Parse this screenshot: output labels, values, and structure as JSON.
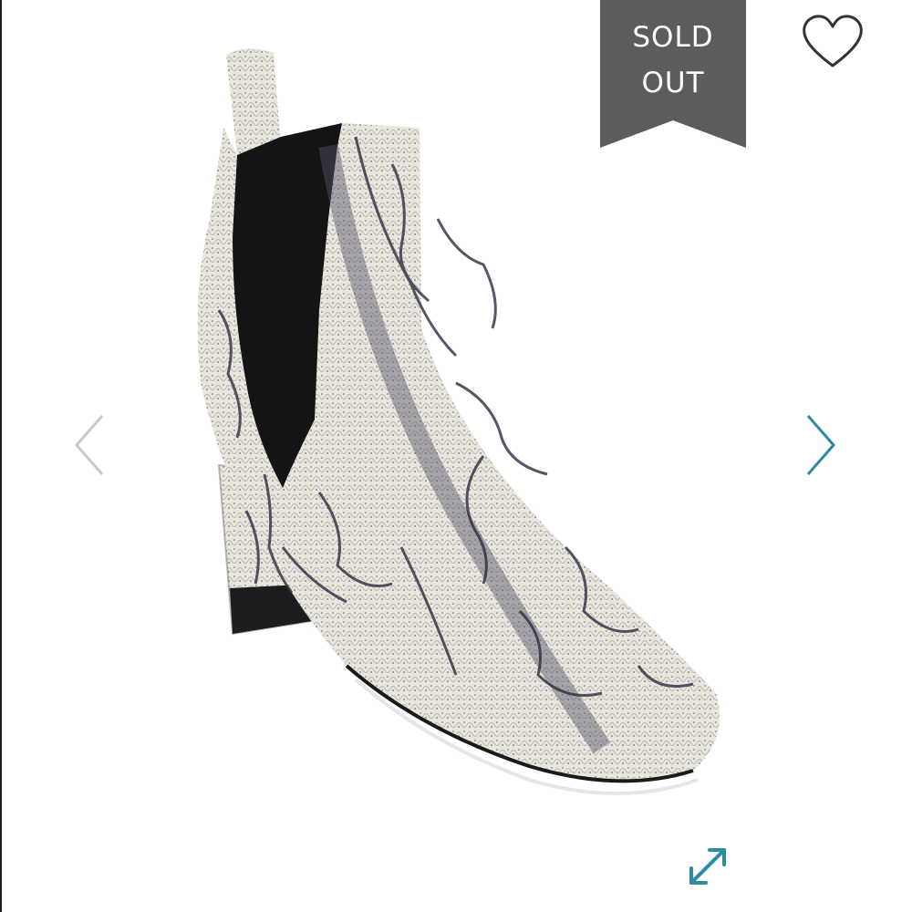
{
  "badge": {
    "line1": "SOLD",
    "line2": "OUT",
    "color": "#5c5c5c"
  },
  "icons": {
    "favorite": "heart-outline-icon",
    "previous": "chevron-left-icon",
    "next": "chevron-right-icon",
    "expand": "expand-arrows-icon"
  },
  "colors": {
    "accent": "#2b8ca3",
    "prev_arrow": "#c8c8c8",
    "heart": "#333333"
  }
}
